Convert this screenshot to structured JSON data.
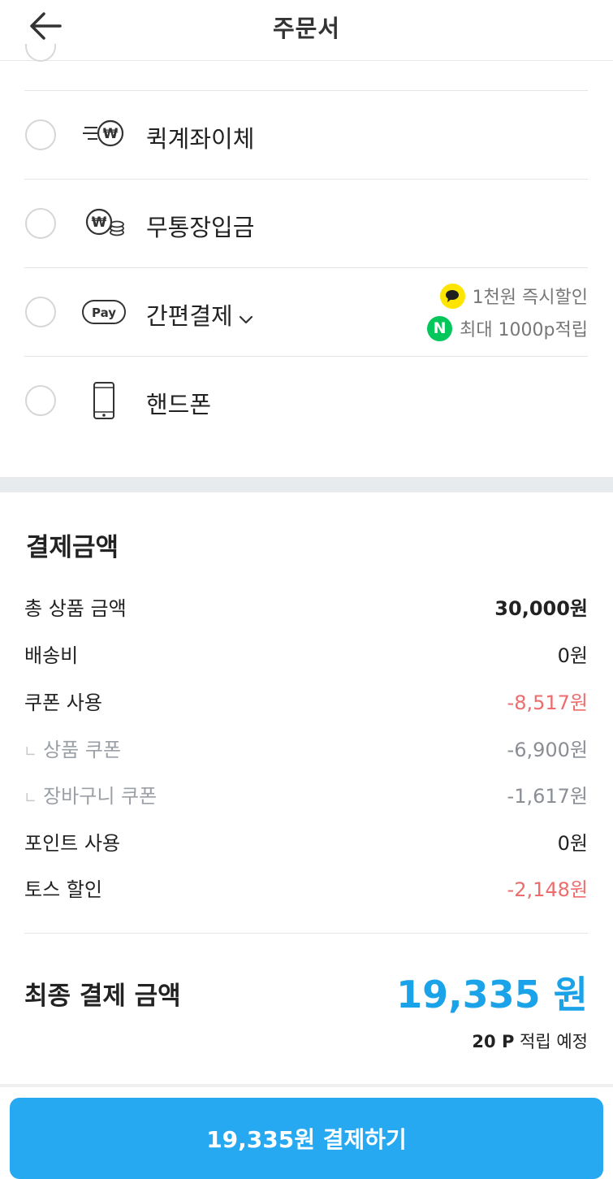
{
  "header": {
    "title": "주문서"
  },
  "payment_methods": [
    {
      "label": "퀵계좌이체",
      "icon": "quick-transfer-icon"
    },
    {
      "label": "무통장입금",
      "icon": "bank-deposit-icon"
    },
    {
      "label": "간편결제",
      "icon": "pay-icon",
      "promos": [
        {
          "text": "1천원 즉시할인",
          "icon": "kakao-talk-icon"
        },
        {
          "text": "최대 1000p적립",
          "icon": "naver-icon",
          "badge_letter": "N"
        }
      ]
    },
    {
      "label": "핸드폰",
      "icon": "phone-icon"
    }
  ],
  "pay_icon_text": "Pay",
  "summary": {
    "title": "결제금액",
    "lines": [
      {
        "label": "총 상품 금액",
        "value": "30,000원"
      },
      {
        "label": "배송비",
        "value": "0원"
      },
      {
        "label": "쿠폰 사용",
        "value": "-8,517원"
      },
      {
        "label": "상품 쿠폰",
        "value": "-6,900원"
      },
      {
        "label": "장바구니 쿠폰",
        "value": "-1,617원"
      },
      {
        "label": "포인트 사용",
        "value": "0원"
      },
      {
        "label": "토스 할인",
        "value": "-2,148원"
      }
    ],
    "final_label": "최종 결제 금액",
    "final_amount": "19,335 원",
    "points_amount": "20 P",
    "points_suffix": "적립 예정"
  },
  "pay_button": {
    "label": "19,335원 결제하기"
  },
  "colors": {
    "accent": "#27a9f1",
    "final_amount": "#1aa3e8",
    "discount": "#ef6c6c",
    "kakao": "#fee500",
    "naver": "#03c75a"
  }
}
